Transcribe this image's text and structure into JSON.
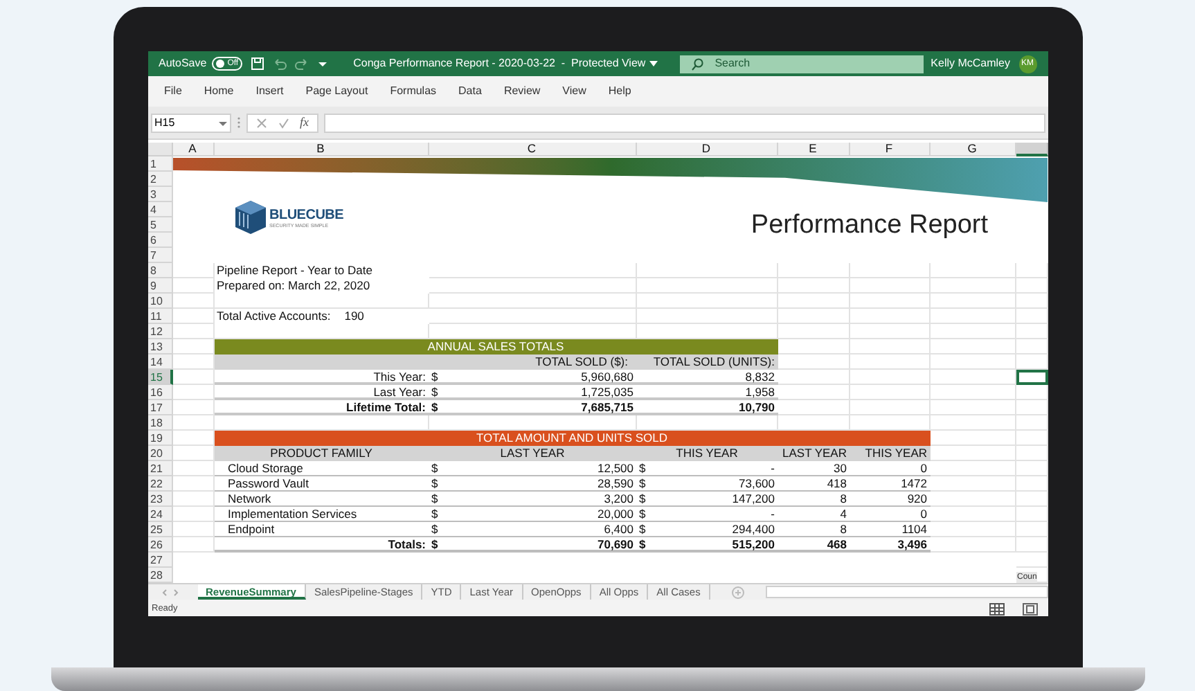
{
  "title_bar": {
    "autosave_label": "AutoSave",
    "autosave_state": "Off",
    "autosave_on": false,
    "document_title": "Conga Performance Report - 2020-03-22  -  Protected View",
    "search_placeholder": "Search",
    "user_name": "Kelly McCamley",
    "user_initials": "KM"
  },
  "menu": [
    "File",
    "Home",
    "Insert",
    "Page Layout",
    "Formulas",
    "Data",
    "Review",
    "View",
    "Help"
  ],
  "formula_bar": {
    "name_box": "H15",
    "function_label": "fx"
  },
  "columns": [
    {
      "label": "A",
      "selected": false
    },
    {
      "label": "B",
      "selected": false
    },
    {
      "label": "C",
      "selected": false
    },
    {
      "label": "D",
      "selected": false
    },
    {
      "label": "E",
      "selected": false
    },
    {
      "label": "F",
      "selected": false
    },
    {
      "label": "G",
      "selected": false
    },
    {
      "selected": true
    }
  ],
  "rows": [
    {
      "label": "1",
      "selected": false
    },
    {
      "label": "2",
      "selected": false
    },
    {
      "label": "3",
      "selected": false
    },
    {
      "label": "4",
      "selected": false
    },
    {
      "label": "5",
      "selected": false
    },
    {
      "label": "6",
      "selected": false
    },
    {
      "label": "7",
      "selected": false
    },
    {
      "label": "8",
      "selected": false
    },
    {
      "label": "9",
      "selected": false
    },
    {
      "label": "10",
      "selected": false
    },
    {
      "label": "11",
      "selected": false
    },
    {
      "label": "12",
      "selected": false
    },
    {
      "label": "13",
      "selected": false
    },
    {
      "label": "14",
      "selected": false
    },
    {
      "label": "15",
      "selected": true
    },
    {
      "label": "16",
      "selected": false
    },
    {
      "label": "17",
      "selected": false
    },
    {
      "label": "18",
      "selected": false
    },
    {
      "label": "19",
      "selected": false
    },
    {
      "label": "20",
      "selected": false
    },
    {
      "label": "21",
      "selected": false
    },
    {
      "label": "22",
      "selected": false
    },
    {
      "label": "23",
      "selected": false
    },
    {
      "label": "24",
      "selected": false
    },
    {
      "label": "25",
      "selected": false
    },
    {
      "label": "26",
      "selected": false
    },
    {
      "label": "27",
      "selected": false
    },
    {
      "label": "28",
      "selected": false
    }
  ],
  "report": {
    "logo_name": "BLUECUBE",
    "logo_tagline": "SECURITY MADE SIMPLE",
    "title": "Performance Report",
    "pipeline_line": "Pipeline Report - Year to Date",
    "prepared_line": "Prepared on: March 22, 2020",
    "accounts_label": "Total Active Accounts:",
    "accounts_value": "190"
  },
  "annual_sales": {
    "title": "ANNUAL SALES TOTALS",
    "headers": [
      "TOTAL SOLD ($):",
      "TOTAL SOLD (UNITS):"
    ],
    "rows": [
      {
        "label": "This Year:",
        "currency": "$",
        "amount": "5,960,680",
        "units": "8,832",
        "kind": "item"
      },
      {
        "label": "Last Year:",
        "currency": "$",
        "amount": "1,725,035",
        "units": "1,958",
        "kind": "item"
      },
      {
        "label": "Lifetime Total:",
        "currency": "$",
        "amount": "7,685,715",
        "units": "10,790",
        "kind": "total"
      }
    ]
  },
  "units_sold": {
    "title": "TOTAL AMOUNT AND UNITS SOLD",
    "headers": [
      "PRODUCT FAMILY",
      "LAST YEAR",
      "THIS YEAR",
      "LAST YEAR",
      "THIS YEAR"
    ],
    "rows": [
      {
        "product": "Cloud Storage",
        "currency_last": "$",
        "last_year": "12,500",
        "currency_this": "$",
        "this_year": "-",
        "units_last": "30",
        "units_this": "0",
        "kind": "item"
      },
      {
        "product": "Password Vault",
        "currency_last": "$",
        "last_year": "28,590",
        "currency_this": "$",
        "this_year": "73,600",
        "units_last": "418",
        "units_this": "1472",
        "kind": "item"
      },
      {
        "product": "Network",
        "currency_last": "$",
        "last_year": "3,200",
        "currency_this": "$",
        "this_year": "147,200",
        "units_last": "8",
        "units_this": "920",
        "kind": "item"
      },
      {
        "product": "Implementation Services",
        "currency_last": "$",
        "last_year": "20,000",
        "currency_this": "$",
        "this_year": "-",
        "units_last": "4",
        "units_this": "0",
        "kind": "item"
      },
      {
        "product": "Endpoint",
        "currency_last": "$",
        "last_year": "6,400",
        "currency_this": "$",
        "this_year": "294,400",
        "units_last": "8",
        "units_this": "1104",
        "kind": "item"
      },
      {
        "product": "Totals:",
        "currency_last": "$",
        "last_year": "70,690",
        "currency_this": "$",
        "this_year": "515,200",
        "units_last": "468",
        "units_this": "3,496",
        "kind": "total"
      }
    ]
  },
  "chart_label_fragment": "Coun",
  "sheet_tabs": [
    {
      "label": "RevenueSummary",
      "selected": true
    },
    {
      "label": "SalesPipeline-Stages",
      "selected": false
    },
    {
      "label": "YTD",
      "selected": false
    },
    {
      "label": "Last Year",
      "selected": false
    },
    {
      "label": "OpenOpps",
      "selected": false
    },
    {
      "label": "All Opps",
      "selected": false
    },
    {
      "label": "All Cases",
      "selected": false
    }
  ],
  "status": "Ready"
}
